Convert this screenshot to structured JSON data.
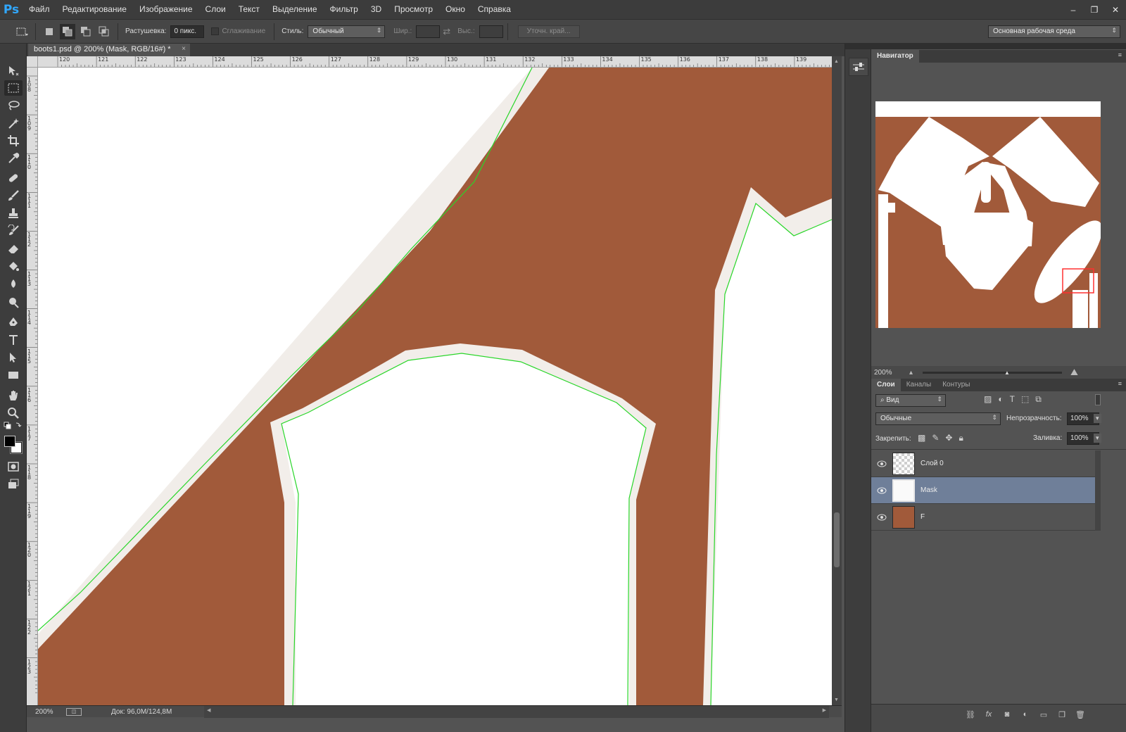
{
  "app": {
    "logo": "Ps"
  },
  "menu": [
    "Файл",
    "Редактирование",
    "Изображение",
    "Слои",
    "Текст",
    "Выделение",
    "Фильтр",
    "3D",
    "Просмотр",
    "Окно",
    "Справка"
  ],
  "window_controls": {
    "minimize": "‒",
    "restore": "❐",
    "close": "✕"
  },
  "options": {
    "feather_label": "Растушевка:",
    "feather_value": "0 пикс.",
    "antialias_label": "Сглаживание",
    "style_label": "Стиль:",
    "style_value": "Обычный",
    "width_label": "Шир.:",
    "height_label": "Выс.:",
    "refine_edge": "Уточн. край...",
    "workspace": "Основная рабочая среда"
  },
  "document": {
    "tab_title": "boots1.psd @ 200% (Mask, RGB/16#) *",
    "close": "×",
    "ruler_h": [
      "120",
      "121",
      "122",
      "123",
      "124",
      "125",
      "126",
      "127",
      "128",
      "129",
      "130",
      "131",
      "132",
      "133",
      "134",
      "135",
      "136",
      "137",
      "138",
      "139"
    ],
    "ruler_v": [
      "108",
      "109",
      "110",
      "111",
      "112",
      "113",
      "114",
      "115",
      "116",
      "117",
      "118",
      "119",
      "120",
      "121",
      "122",
      "123"
    ],
    "zoom": "200%",
    "doc_info": "Док: 96,0M/124,8M",
    "colors": {
      "canvas_brown": "#a15a3a",
      "shape_white": "#ffffff",
      "selection_green": "#22dd22"
    }
  },
  "navigator": {
    "title": "Навигатор",
    "zoom": "200%"
  },
  "layers_panel": {
    "tabs": [
      "Слои",
      "Каналы",
      "Контуры"
    ],
    "filter_kind": "Вид",
    "blend_mode": "Обычные",
    "opacity_label": "Непрозрачность:",
    "opacity_value": "100%",
    "lock_label": "Закрепить:",
    "fill_label": "Заливка:",
    "fill_value": "100%",
    "layers": [
      {
        "name": "Слой 0",
        "selected": false
      },
      {
        "name": "Mask",
        "selected": true
      },
      {
        "name": "F",
        "selected": false
      }
    ]
  }
}
